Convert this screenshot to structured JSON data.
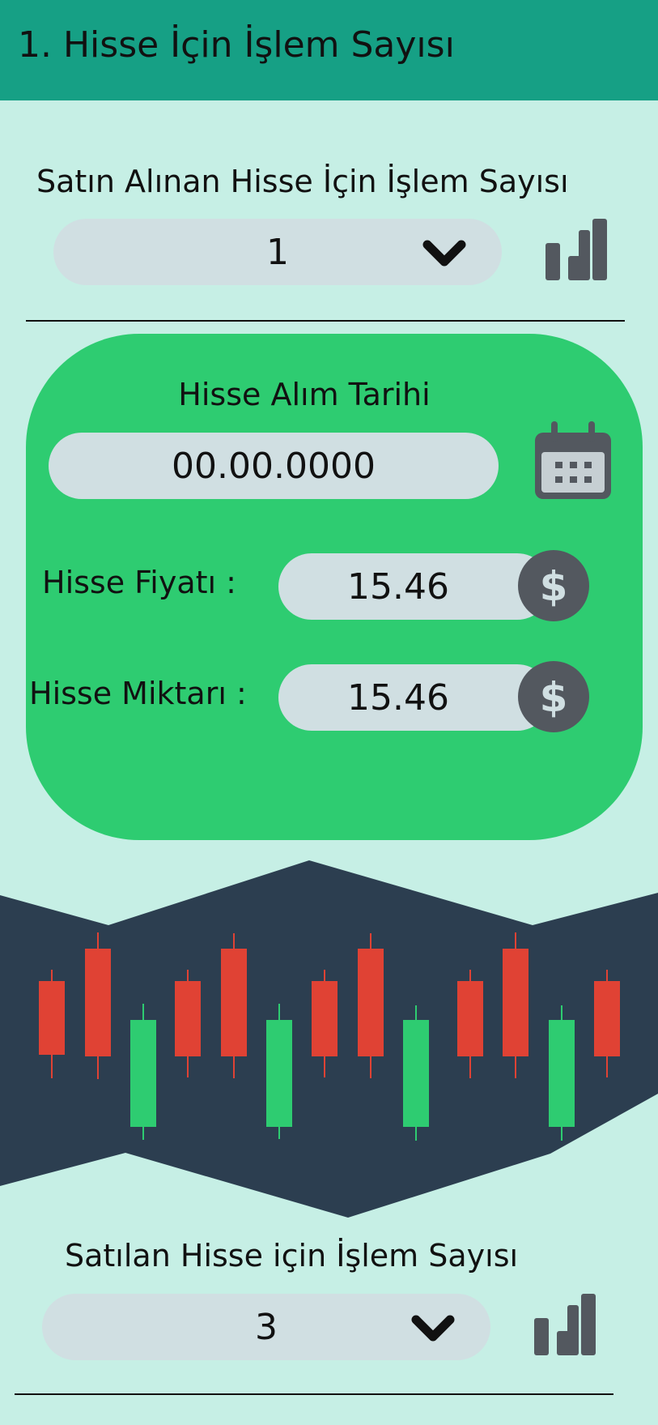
{
  "header": {
    "title": "1. Hisse İçin İşlem Sayısı"
  },
  "buy": {
    "label": "Satın Alınan Hisse İçin İşlem Sayısı",
    "value": "1"
  },
  "card": {
    "date_label": "Hisse Alım Tarihi",
    "date_value": "00.00.0000",
    "price_label": "Hisse Fiyatı :",
    "price_value": "15.46",
    "qty_label": "Hisse Miktarı :",
    "qty_value": "15.46"
  },
  "sell": {
    "label": "Satılan Hisse için İşlem Sayısı",
    "value": "3"
  },
  "colors": {
    "header": "#16a085",
    "background": "#c6efe5",
    "card": "#2ecc71",
    "banner": "#2c3e50",
    "candle_up": "#2ecc71",
    "candle_down": "#e04234",
    "icon": "#53585f"
  },
  "icons": [
    "chevron-down-icon",
    "bar-chart-icon",
    "calendar-icon",
    "dollar-icon"
  ]
}
